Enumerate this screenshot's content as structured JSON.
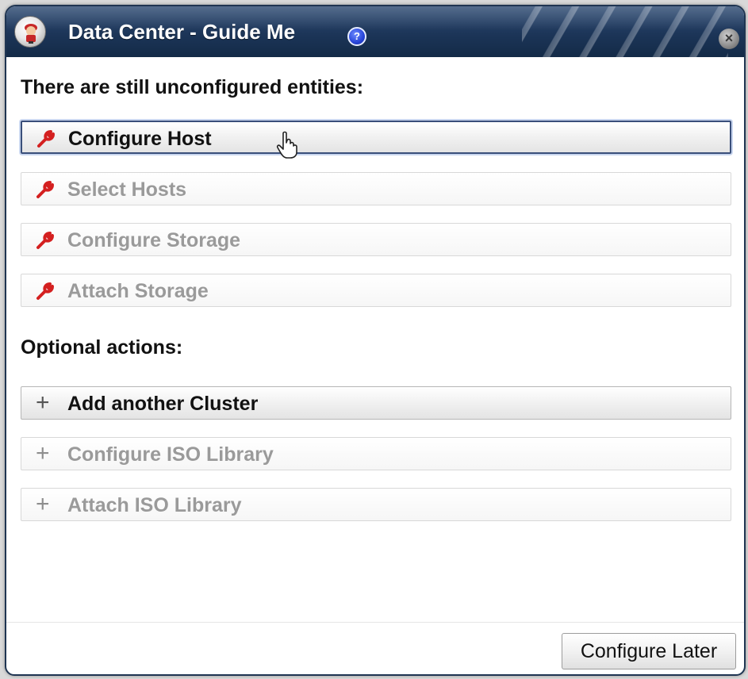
{
  "dialog": {
    "title": "Data Center - Guide Me",
    "help_icon": "question-icon",
    "close_icon": "close-icon"
  },
  "required": {
    "heading": "There are still unconfigured entities:",
    "icon": "wrench-icon",
    "icon_color": "#d42020",
    "items": [
      {
        "label": "Configure Host",
        "enabled": true,
        "focused": true
      },
      {
        "label": "Select Hosts",
        "enabled": false
      },
      {
        "label": "Configure Storage",
        "enabled": false
      },
      {
        "label": "Attach Storage",
        "enabled": false
      }
    ]
  },
  "optional": {
    "heading": "Optional actions:",
    "icon": "plus-icon",
    "items": [
      {
        "label": "Add another Cluster",
        "enabled": true
      },
      {
        "label": "Configure ISO Library",
        "enabled": false
      },
      {
        "label": "Attach ISO Library",
        "enabled": false
      }
    ]
  },
  "footer": {
    "configure_later_label": "Configure Later"
  },
  "colors": {
    "titlebar": "#1c3558",
    "disabled_text": "#9a9a9a",
    "focus_border": "#3a4f7a"
  }
}
